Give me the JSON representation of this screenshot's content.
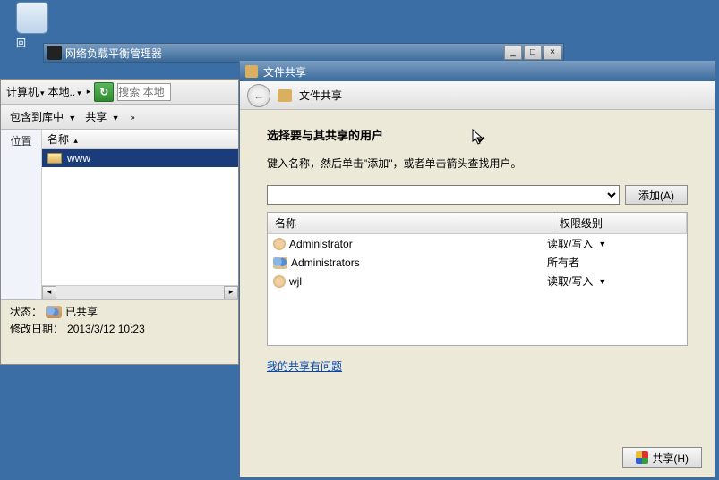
{
  "desktop": {
    "recycle_bin": "回"
  },
  "nlb": {
    "title": "网络负载平衡管理器",
    "min": "_",
    "max": "□",
    "close": "×"
  },
  "explorer": {
    "computer_dropdown": "计算机",
    "location_dropdown": "本地..",
    "search_placeholder": "搜索 本地",
    "include_lib": "包含到库中",
    "share_btn": "共享",
    "side_label": "位置",
    "name_col": "名称",
    "file_www": "www",
    "status_label": "状态：",
    "status_value": "已共享",
    "modified_label": "修改日期：",
    "modified_value": "2013/3/12 10:23"
  },
  "share": {
    "window_title": "文件共享",
    "crumb": "文件共享",
    "heading": "选择要与其共享的用户",
    "instruction": "键入名称，然后单击\"添加\"，或者单击箭头查找用户。",
    "add_btn": "添加(A)",
    "col_name": "名称",
    "col_perm": "权限级别",
    "rows": [
      {
        "name": "Administrator",
        "perm": "读取/写入",
        "icon": "user",
        "dd": true
      },
      {
        "name": "Administrators",
        "perm": "所有者",
        "icon": "group",
        "dd": false
      },
      {
        "name": "wjl",
        "perm": "读取/写入",
        "icon": "user",
        "dd": true
      }
    ],
    "help_link": "我的共享有问题",
    "share_button": "共享(H)"
  }
}
